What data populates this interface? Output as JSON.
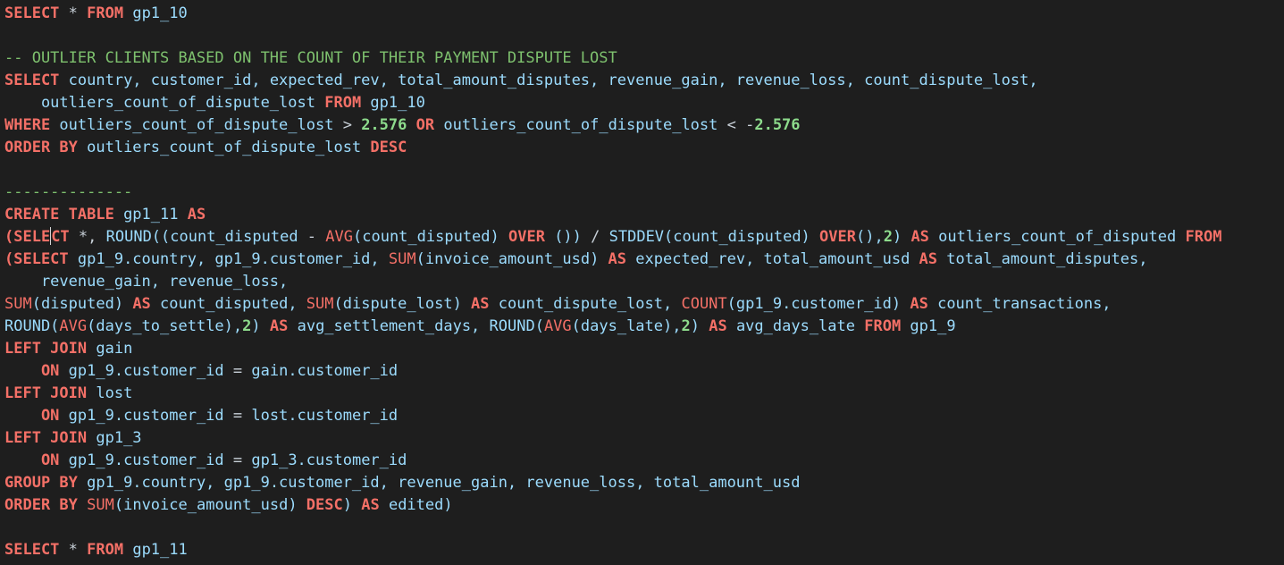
{
  "editor": {
    "lines": [
      [
        [
          "kw",
          "SELECT"
        ],
        [
          "op",
          " * "
        ],
        [
          "kw",
          "FROM"
        ],
        [
          "id",
          " gp1_10"
        ]
      ],
      [],
      [
        [
          "cm",
          "-- OUTLIER CLIENTS BASED ON THE COUNT OF THEIR PAYMENT DISPUTE LOST"
        ]
      ],
      [
        [
          "kw",
          "SELECT"
        ],
        [
          "id",
          " country, customer_id, expected_rev, total_amount_disputes, revenue_gain, revenue_loss, count_dispute_lost,"
        ]
      ],
      [
        [
          "id",
          "    outliers_count_of_dispute_lost "
        ],
        [
          "kw",
          "FROM"
        ],
        [
          "id",
          " gp1_10"
        ]
      ],
      [
        [
          "kw",
          "WHERE"
        ],
        [
          "id",
          " outliers_count_of_dispute_lost "
        ],
        [
          "op",
          "> "
        ],
        [
          "num",
          "2.576"
        ],
        [
          "id",
          " "
        ],
        [
          "kw",
          "OR"
        ],
        [
          "id",
          " outliers_count_of_dispute_lost "
        ],
        [
          "op",
          "< -"
        ],
        [
          "num",
          "2.576"
        ]
      ],
      [
        [
          "kw",
          "ORDER BY"
        ],
        [
          "id",
          " outliers_count_of_dispute_lost "
        ],
        [
          "kw",
          "DESC"
        ]
      ],
      [],
      [
        [
          "cm",
          "--------------"
        ]
      ],
      [
        [
          "kw",
          "CREATE TABLE"
        ],
        [
          "id",
          " gp1_11 "
        ],
        [
          "kw",
          "AS"
        ]
      ],
      [
        [
          "kw",
          "(SELE"
        ],
        [
          "caret",
          ""
        ],
        [
          "kw",
          "CT"
        ],
        [
          "op",
          " *, "
        ],
        [
          "id",
          "ROUND((count_disputed "
        ],
        [
          "op",
          "- "
        ],
        [
          "fn",
          "AVG"
        ],
        [
          "id",
          "(count_disputed) "
        ],
        [
          "kw",
          "OVER"
        ],
        [
          "id",
          " ()) "
        ],
        [
          "op",
          "/ "
        ],
        [
          "id",
          "STDDEV(count_disputed) "
        ],
        [
          "kw",
          "OVER"
        ],
        [
          "id",
          "(),"
        ],
        [
          "num",
          "2"
        ],
        [
          "id",
          ") "
        ],
        [
          "kw",
          "AS"
        ],
        [
          "id",
          " outliers_count_of_disputed "
        ],
        [
          "kw",
          "FROM"
        ]
      ],
      [
        [
          "kw",
          "(SELECT"
        ],
        [
          "id",
          " gp1_9.country, gp1_9.customer_id, "
        ],
        [
          "fn",
          "SUM"
        ],
        [
          "id",
          "(invoice_amount_usd) "
        ],
        [
          "kw",
          "AS"
        ],
        [
          "id",
          " expected_rev, total_amount_usd "
        ],
        [
          "kw",
          "AS"
        ],
        [
          "id",
          " total_amount_disputes,"
        ]
      ],
      [
        [
          "id",
          "    revenue_gain, revenue_loss,"
        ]
      ],
      [
        [
          "fn",
          "SUM"
        ],
        [
          "id",
          "(disputed) "
        ],
        [
          "kw",
          "AS"
        ],
        [
          "id",
          " count_disputed, "
        ],
        [
          "fn",
          "SUM"
        ],
        [
          "id",
          "(dispute_lost) "
        ],
        [
          "kw",
          "AS"
        ],
        [
          "id",
          " count_dispute_lost, "
        ],
        [
          "fn",
          "COUNT"
        ],
        [
          "id",
          "(gp1_9.customer_id) "
        ],
        [
          "kw",
          "AS"
        ],
        [
          "id",
          " count_transactions,"
        ]
      ],
      [
        [
          "id",
          "ROUND("
        ],
        [
          "fn",
          "AVG"
        ],
        [
          "id",
          "(days_to_settle),"
        ],
        [
          "num",
          "2"
        ],
        [
          "id",
          ") "
        ],
        [
          "kw",
          "AS"
        ],
        [
          "id",
          " avg_settlement_days, ROUND("
        ],
        [
          "fn",
          "AVG"
        ],
        [
          "id",
          "(days_late),"
        ],
        [
          "num",
          "2"
        ],
        [
          "id",
          ") "
        ],
        [
          "kw",
          "AS"
        ],
        [
          "id",
          " avg_days_late "
        ],
        [
          "kw",
          "FROM"
        ],
        [
          "id",
          " gp1_9"
        ]
      ],
      [
        [
          "kw",
          "LEFT JOIN"
        ],
        [
          "id",
          " gain"
        ]
      ],
      [
        [
          "kw",
          "    ON"
        ],
        [
          "id",
          " gp1_9.customer_id "
        ],
        [
          "op",
          "= "
        ],
        [
          "id",
          "gain.customer_id"
        ]
      ],
      [
        [
          "kw",
          "LEFT JOIN"
        ],
        [
          "id",
          " lost"
        ]
      ],
      [
        [
          "kw",
          "    ON"
        ],
        [
          "id",
          " gp1_9.customer_id "
        ],
        [
          "op",
          "= "
        ],
        [
          "id",
          "lost.customer_id"
        ]
      ],
      [
        [
          "kw",
          "LEFT JOIN"
        ],
        [
          "id",
          " gp1_3"
        ]
      ],
      [
        [
          "kw",
          "    ON"
        ],
        [
          "id",
          " gp1_9.customer_id "
        ],
        [
          "op",
          "= "
        ],
        [
          "id",
          "gp1_3.customer_id"
        ]
      ],
      [
        [
          "kw",
          "GROUP BY"
        ],
        [
          "id",
          " gp1_9.country, gp1_9.customer_id, revenue_gain, revenue_loss, total_amount_usd"
        ]
      ],
      [
        [
          "kw",
          "ORDER BY"
        ],
        [
          "id",
          " "
        ],
        [
          "fn",
          "SUM"
        ],
        [
          "id",
          "(invoice_amount_usd) "
        ],
        [
          "kw",
          "DESC"
        ],
        [
          "id",
          ") "
        ],
        [
          "kw",
          "AS"
        ],
        [
          "id",
          " edited)"
        ]
      ],
      [],
      [
        [
          "kw",
          "SELECT"
        ],
        [
          "op",
          " * "
        ],
        [
          "kw",
          "FROM"
        ],
        [
          "id",
          " gp1_11"
        ]
      ]
    ]
  }
}
